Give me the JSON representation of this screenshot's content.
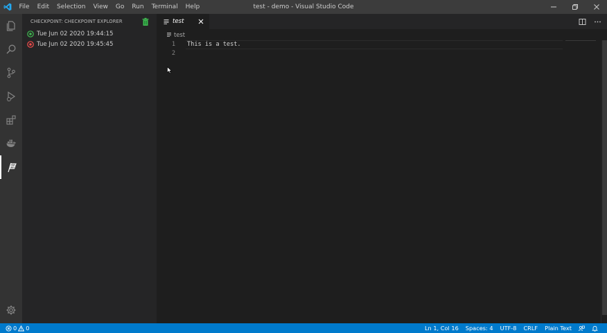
{
  "window": {
    "title": "test - demo - Visual Studio Code",
    "menu": [
      "File",
      "Edit",
      "Selection",
      "View",
      "Go",
      "Run",
      "Terminal",
      "Help"
    ]
  },
  "activity_bar": {
    "items": [
      "files-icon",
      "search-icon",
      "source-control-icon",
      "run-debug-icon",
      "extensions-icon",
      "docker-icon",
      "checkpoint-icon"
    ],
    "active": "checkpoint-icon",
    "bottom": "settings-gear-icon"
  },
  "sidebar": {
    "title": "CHECKPOINT: CHECKPOINT EXPLORER",
    "checkpoints": [
      {
        "label": "Tue Jun 02 2020 19:44:15",
        "status": "current",
        "color": "#3fb950"
      },
      {
        "label": "Tue Jun 02 2020 19:45:45",
        "status": "other",
        "color": "#f14c4c"
      }
    ]
  },
  "editor": {
    "tab": {
      "label": "test",
      "preview": true
    },
    "breadcrumb": "test",
    "lines": [
      {
        "num": "1",
        "text": "This is a test."
      },
      {
        "num": "2",
        "text": ""
      }
    ],
    "cursor_line": 1
  },
  "status_bar": {
    "errors": "0",
    "warnings": "0",
    "position": "Ln 1, Col 16",
    "spaces": "Spaces: 4",
    "encoding": "UTF-8",
    "eol": "CRLF",
    "language": "Plain Text"
  },
  "colors": {
    "accent": "#007acc",
    "activity_bar": "#333333",
    "sidebar": "#252526",
    "editor": "#1e1e1e",
    "titlebar": "#3c3c3c"
  }
}
